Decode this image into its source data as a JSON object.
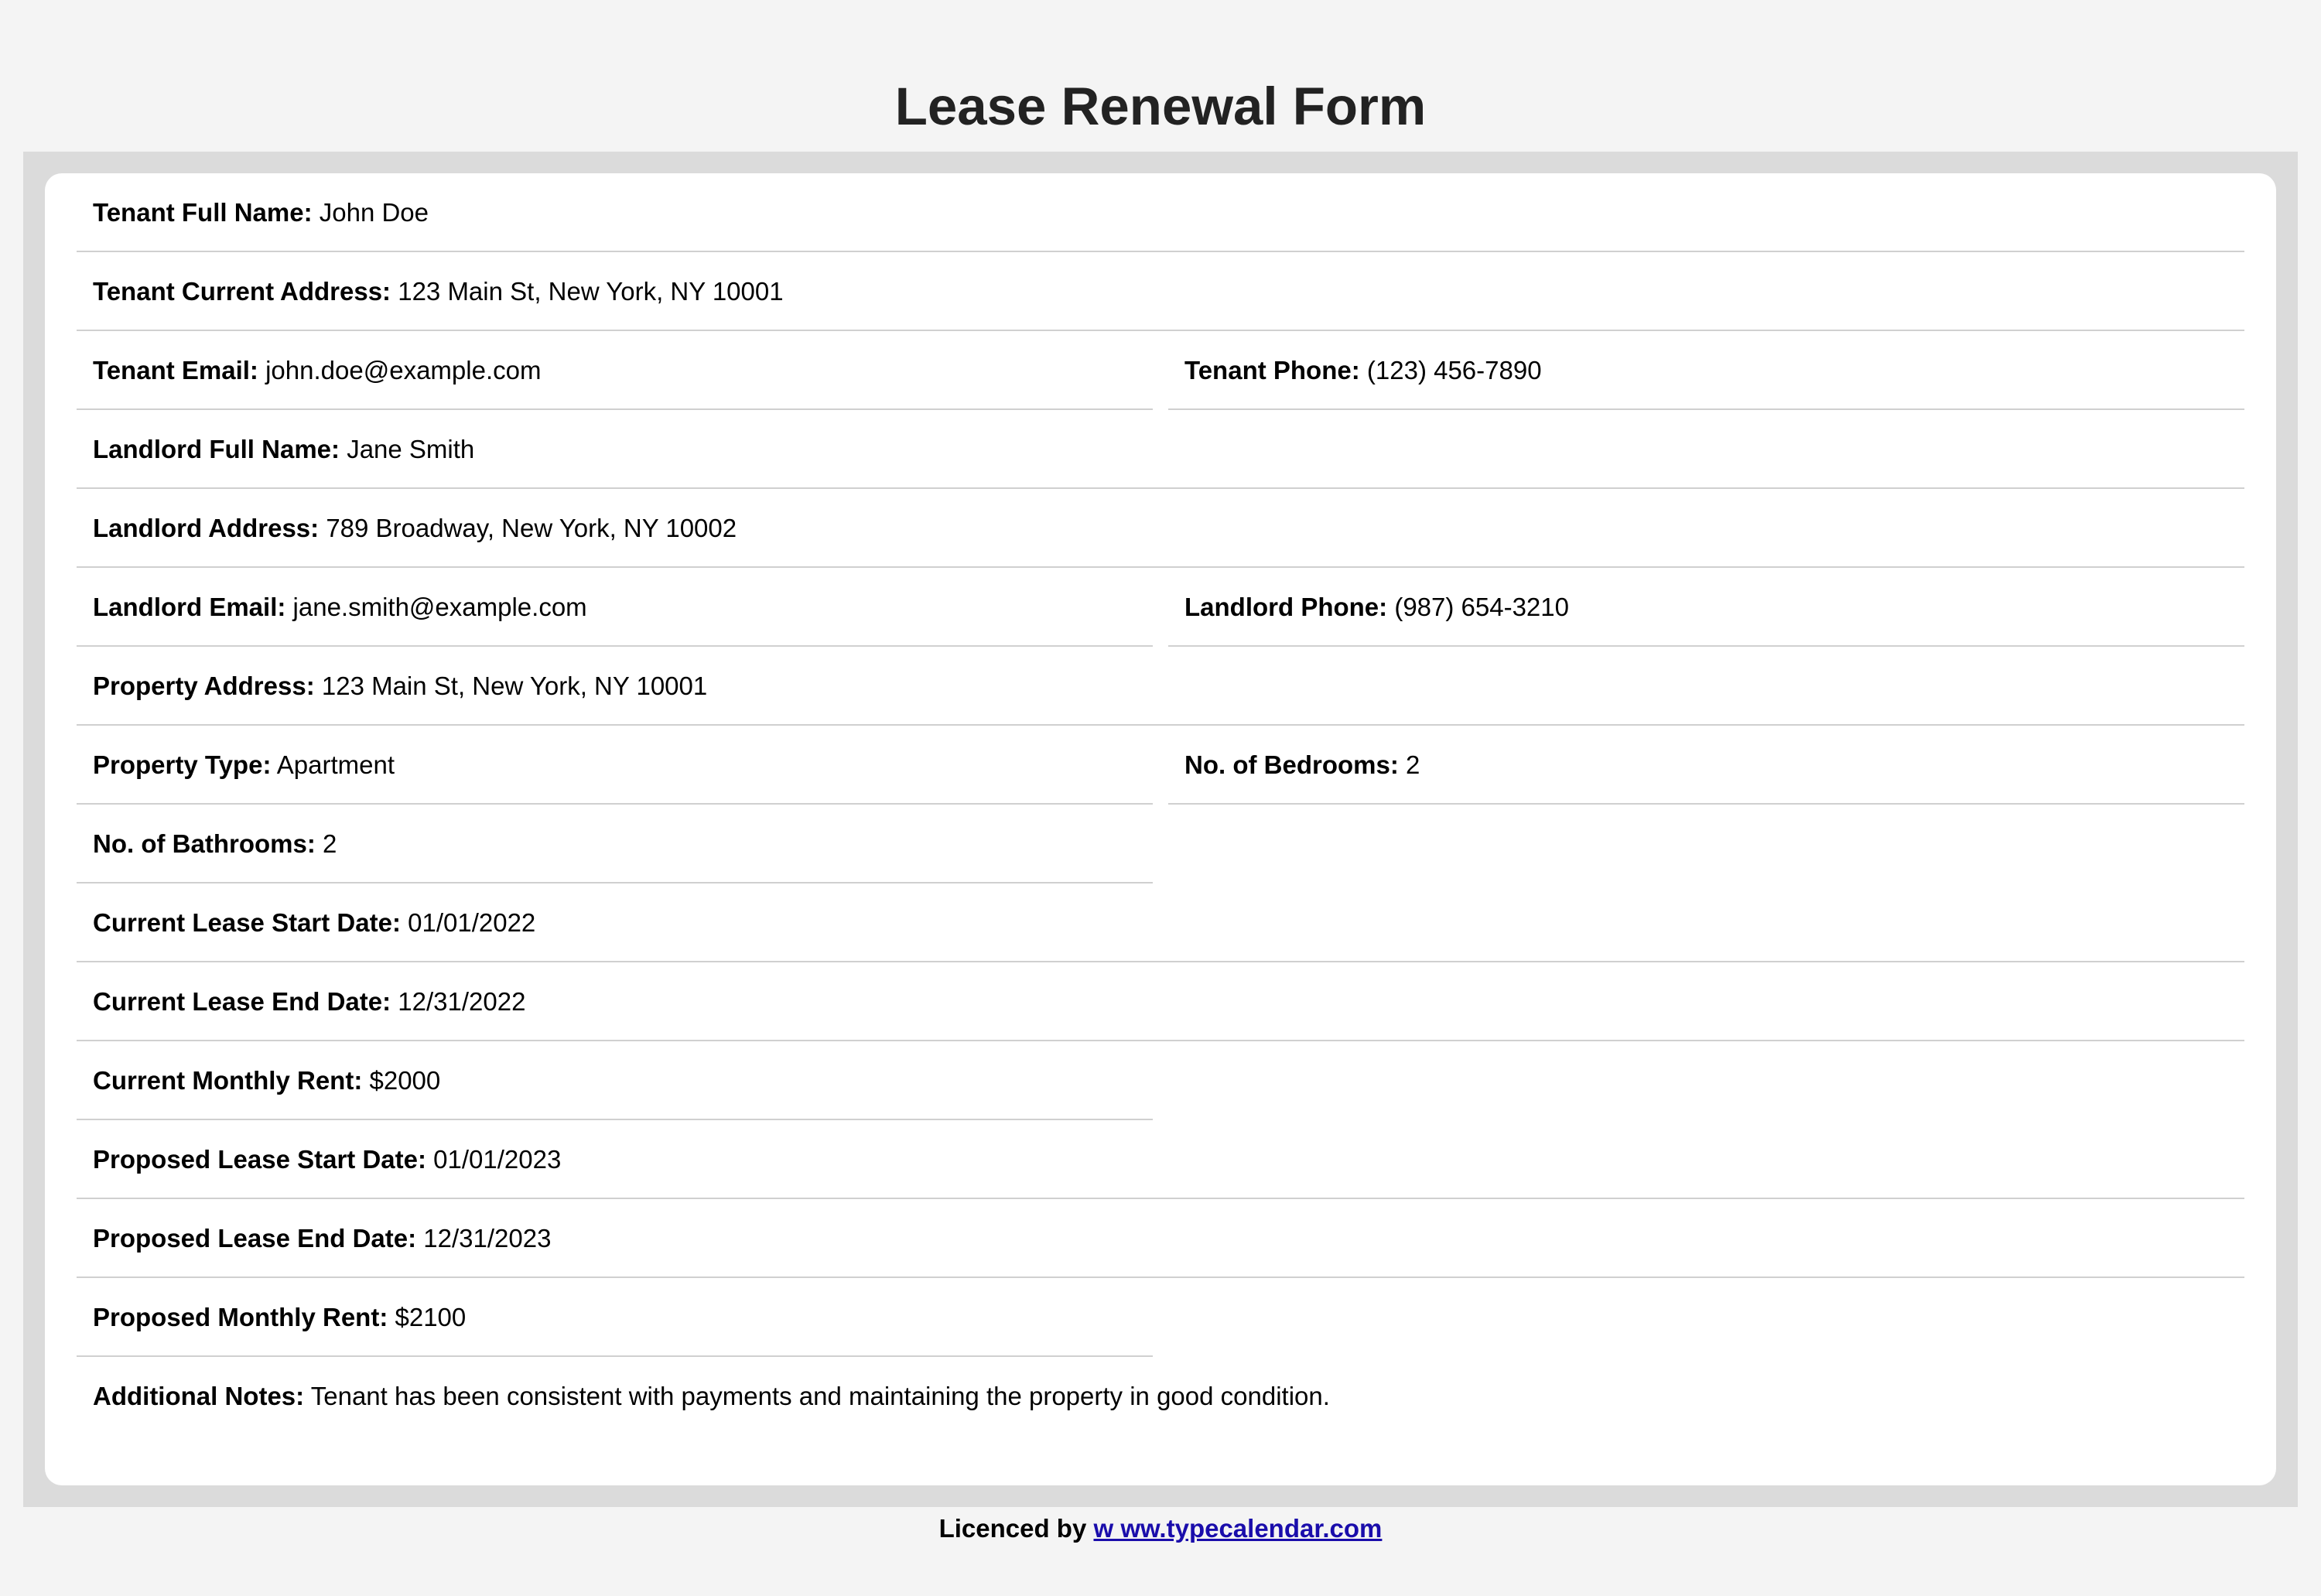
{
  "title": "Lease Renewal Form",
  "fields": {
    "tenant_name": {
      "label": "Tenant Full Name:",
      "value": "John Doe"
    },
    "tenant_address": {
      "label": "Tenant Current Address:",
      "value": "123 Main St, New York, NY 10001"
    },
    "tenant_email": {
      "label": "Tenant Email:",
      "value": "john.doe@example.com"
    },
    "tenant_phone": {
      "label": "Tenant Phone:",
      "value": "(123) 456-7890"
    },
    "landlord_name": {
      "label": "Landlord Full Name:",
      "value": "Jane Smith"
    },
    "landlord_address": {
      "label": "Landlord Address:",
      "value": "789 Broadway, New York, NY 10002"
    },
    "landlord_email": {
      "label": "Landlord Email:",
      "value": "jane.smith@example.com"
    },
    "landlord_phone": {
      "label": "Landlord Phone:",
      "value": "(987) 654-3210"
    },
    "property_address": {
      "label": "Property Address:",
      "value": "123 Main St, New York, NY 10001"
    },
    "property_type": {
      "label": "Property Type:",
      "value": "Apartment"
    },
    "bedrooms": {
      "label": "No. of Bedrooms:",
      "value": "2"
    },
    "bathrooms": {
      "label": "No. of Bathrooms:",
      "value": "2"
    },
    "current_start": {
      "label": "Current Lease Start Date:",
      "value": "01/01/2022"
    },
    "current_end": {
      "label": "Current Lease End Date:",
      "value": "12/31/2022"
    },
    "current_rent": {
      "label": "Current Monthly Rent:",
      "value": "$2000"
    },
    "proposed_start": {
      "label": "Proposed Lease Start Date:",
      "value": "01/01/2023"
    },
    "proposed_end": {
      "label": "Proposed Lease End Date:",
      "value": "12/31/2023"
    },
    "proposed_rent": {
      "label": "Proposed Monthly Rent:",
      "value": "$2100"
    },
    "notes": {
      "label": "Additional Notes:",
      "value": "Tenant has been consistent with payments and maintaining the property in good condition."
    }
  },
  "footer": {
    "prefix": "Licenced by",
    "link_text": "w   ww.typecalendar.com"
  }
}
